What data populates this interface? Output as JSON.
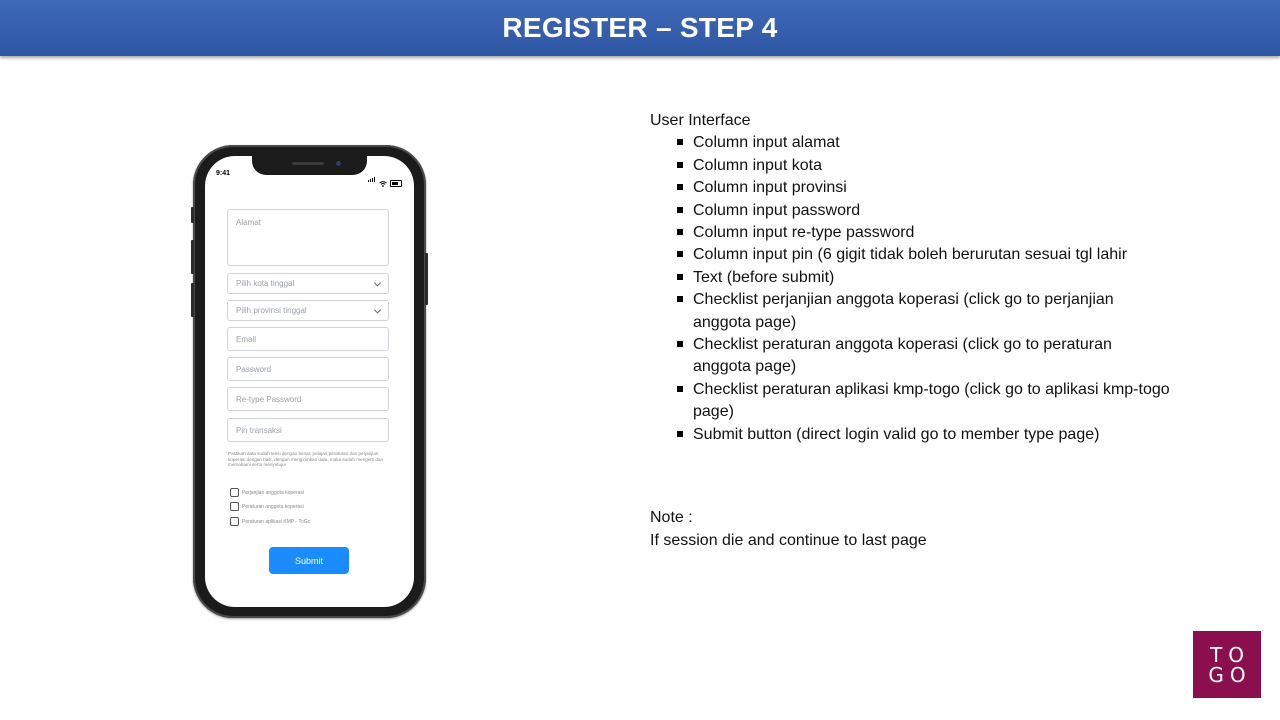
{
  "header": {
    "title": "REGISTER – STEP 4"
  },
  "phone": {
    "status_time": "9:41",
    "fields": {
      "alamat": "Alamat",
      "kota": "Pilih kota tinggal",
      "provinsi": "Pilih provinsi tinggal",
      "email": "Email",
      "password": "Password",
      "retype_password": "Re-type Password",
      "pin": "Pin transaksi"
    },
    "disclaimer": "Pastikan data sudah terisi dengan benar, pelajari peraturan dan perjanjian koperasi dengan baik, dengan mengirimkan data, maka sudah mengerti dan memahami serta menyetujui",
    "checkboxes": [
      "Perjanjian anggota koperasi",
      "Peraturan anggota koperasi",
      "Peraturan aplikasi KMP - ToGo"
    ],
    "submit_label": "Submit"
  },
  "description": {
    "heading": "User Interface",
    "items": [
      "Column input alamat",
      "Column input kota",
      "Column input provinsi",
      "Column input password",
      "Column input re-type password",
      "Column input pin (6 gigit tidak boleh berurutan sesuai tgl lahir",
      "Text (before submit)",
      "Checklist perjanjian anggota koperasi (click go to perjanjian anggota page)",
      "Checklist peraturan anggota koperasi (click go to peraturan anggota page)",
      "Checklist peraturan aplikasi kmp-togo (click go to aplikasi kmp-togo page)",
      "Submit button (direct login valid go to member type page)"
    ]
  },
  "note": {
    "label": "Note :",
    "text": "If session die and continue to last page"
  },
  "logo": {
    "line1": "TO",
    "line2": "GO"
  },
  "colors": {
    "header": "#2d56a3",
    "logo_bg": "#8b0f4f",
    "submit": "#1a8cff"
  }
}
